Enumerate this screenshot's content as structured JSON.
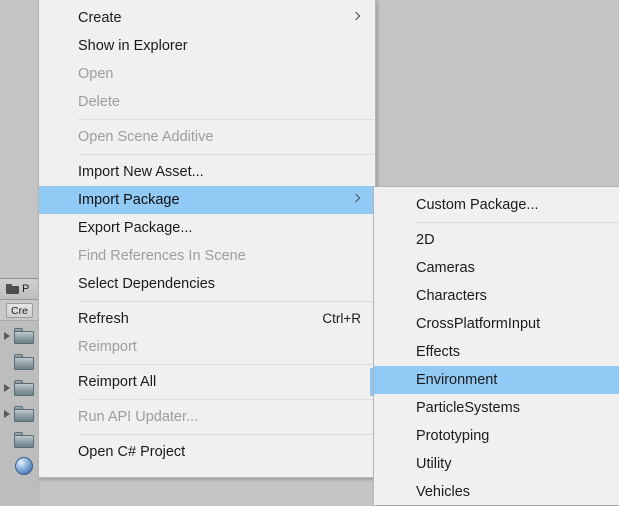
{
  "app": {
    "background_color": "#c4c4c4",
    "highlight_color": "#91caf5",
    "menu_background": "#f0f0f0"
  },
  "project_panel": {
    "tab_label": "P",
    "tab_icon": "folder-icon",
    "create_button_label": "Cre",
    "rows": [
      {
        "icon": "folder-icon",
        "expandable": true
      },
      {
        "icon": "folder-icon",
        "expandable": false
      },
      {
        "icon": "folder-icon",
        "expandable": true
      },
      {
        "icon": "folder-icon",
        "expandable": true
      },
      {
        "icon": "folder-icon",
        "expandable": false
      },
      {
        "icon": "sphere-icon",
        "expandable": false
      }
    ]
  },
  "context_menu": {
    "items": [
      {
        "label": "Create",
        "disabled": false,
        "submenu": true,
        "shortcut": "",
        "selected": false
      },
      {
        "label": "Show in Explorer",
        "disabled": false,
        "submenu": false,
        "shortcut": "",
        "selected": false
      },
      {
        "label": "Open",
        "disabled": true,
        "submenu": false,
        "shortcut": "",
        "selected": false
      },
      {
        "label": "Delete",
        "disabled": true,
        "submenu": false,
        "shortcut": "",
        "selected": false
      },
      {
        "separator": true
      },
      {
        "label": "Open Scene Additive",
        "disabled": true,
        "submenu": false,
        "shortcut": "",
        "selected": false
      },
      {
        "separator": true
      },
      {
        "label": "Import New Asset...",
        "disabled": false,
        "submenu": false,
        "shortcut": "",
        "selected": false
      },
      {
        "label": "Import Package",
        "disabled": false,
        "submenu": true,
        "shortcut": "",
        "selected": true
      },
      {
        "label": "Export Package...",
        "disabled": false,
        "submenu": false,
        "shortcut": "",
        "selected": false
      },
      {
        "label": "Find References In Scene",
        "disabled": true,
        "submenu": false,
        "shortcut": "",
        "selected": false
      },
      {
        "label": "Select Dependencies",
        "disabled": false,
        "submenu": false,
        "shortcut": "",
        "selected": false
      },
      {
        "separator": true
      },
      {
        "label": "Refresh",
        "disabled": false,
        "submenu": false,
        "shortcut": "Ctrl+R",
        "selected": false
      },
      {
        "label": "Reimport",
        "disabled": true,
        "submenu": false,
        "shortcut": "",
        "selected": false
      },
      {
        "separator": true
      },
      {
        "label": "Reimport All",
        "disabled": false,
        "submenu": false,
        "shortcut": "",
        "selected": false
      },
      {
        "separator": true
      },
      {
        "label": "Run API Updater...",
        "disabled": true,
        "submenu": false,
        "shortcut": "",
        "selected": false
      },
      {
        "separator": true
      },
      {
        "label": "Open C# Project",
        "disabled": false,
        "submenu": false,
        "shortcut": "",
        "selected": false
      }
    ]
  },
  "submenu": {
    "parent": "Import Package",
    "items": [
      {
        "label": "Custom Package...",
        "selected": false
      },
      {
        "separator": true
      },
      {
        "label": "2D",
        "selected": false
      },
      {
        "label": "Cameras",
        "selected": false
      },
      {
        "label": "Characters",
        "selected": false
      },
      {
        "label": "CrossPlatformInput",
        "selected": false
      },
      {
        "label": "Effects",
        "selected": false
      },
      {
        "label": "Environment",
        "selected": true
      },
      {
        "label": "ParticleSystems",
        "selected": false
      },
      {
        "label": "Prototyping",
        "selected": false
      },
      {
        "label": "Utility",
        "selected": false
      },
      {
        "label": "Vehicles",
        "selected": false
      }
    ]
  }
}
